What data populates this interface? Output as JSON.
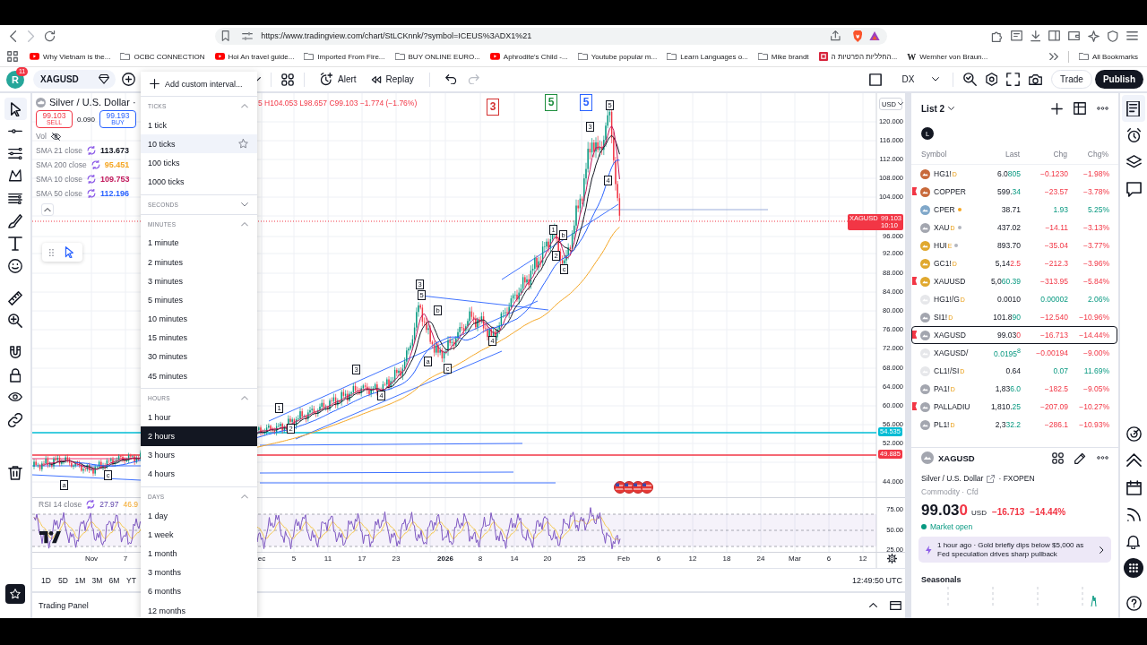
{
  "browser": {
    "url": "https://www.tradingview.com/chart/StLCKnnk/?symbol=ICEUS%3ADX1%21"
  },
  "bookmarks": {
    "items": [
      {
        "label": "Why Vietnam is the...",
        "kind": "video"
      },
      {
        "label": "OCBC CONNECTION",
        "kind": "folder"
      },
      {
        "label": "Hoi An travel guide...",
        "kind": "video"
      },
      {
        "label": "Imported From Fire...",
        "kind": "folder"
      },
      {
        "label": "BUY ONLINE EURO...",
        "kind": "folder"
      },
      {
        "label": "Aphrodite's Child -...",
        "kind": "video"
      },
      {
        "label": "Youtube popular m...",
        "kind": "folder"
      },
      {
        "label": "Learn Languages o...",
        "kind": "folder"
      },
      {
        "label": "Mike brandt",
        "kind": "folder"
      },
      {
        "label": "החלליות הפרטיות ה...",
        "kind": "site"
      },
      {
        "label": "Wernher von Braun...",
        "kind": "wiki",
        "glyph": "W"
      }
    ],
    "all": "All Bookmarks"
  },
  "header": {
    "avatar": "R",
    "notifications": "11",
    "symbol": "XAGUSD",
    "actions": [
      {
        "label": "Alert",
        "kind": "alert"
      },
      {
        "label": "Replay",
        "kind": "replay"
      }
    ],
    "history": [
      {
        "kind": "undo",
        "disabled": false
      },
      {
        "kind": "redo",
        "disabled": true
      }
    ],
    "compare": "DX",
    "buttons": [
      {
        "label": "Trade",
        "kind": "secondary"
      },
      {
        "label": "Publish",
        "kind": "primary"
      }
    ]
  },
  "interval_menu": {
    "add_label": "Add custom interval...",
    "groups": [
      {
        "title": "TICKS",
        "expanded": true,
        "items": [
          {
            "label": "1 tick",
            "selected": false,
            "hovered": false
          },
          {
            "label": "10 ticks",
            "selected": false,
            "hovered": true
          },
          {
            "label": "100 ticks",
            "selected": false,
            "hovered": false
          },
          {
            "label": "1000 ticks",
            "selected": false,
            "hovered": false
          }
        ]
      },
      {
        "title": "SECONDS",
        "expanded": false
      },
      {
        "title": "MINUTES",
        "expanded": true,
        "items": [
          {
            "label": "1 minute",
            "selected": false,
            "hovered": false
          },
          {
            "label": "2 minutes",
            "selected": false,
            "hovered": false
          },
          {
            "label": "3 minutes",
            "selected": false,
            "hovered": false
          },
          {
            "label": "5 minutes",
            "selected": false,
            "hovered": false
          },
          {
            "label": "10 minutes",
            "selected": false,
            "hovered": false
          },
          {
            "label": "15 minutes",
            "selected": false,
            "hovered": false
          },
          {
            "label": "30 minutes",
            "selected": false,
            "hovered": false
          },
          {
            "label": "45 minutes",
            "selected": false,
            "hovered": false
          }
        ]
      },
      {
        "title": "HOURS",
        "expanded": true,
        "items": [
          {
            "label": "1 hour",
            "selected": false,
            "hovered": false
          },
          {
            "label": "2 hours",
            "selected": true,
            "hovered": false
          },
          {
            "label": "3 hours",
            "selected": false,
            "hovered": false
          },
          {
            "label": "4 hours",
            "selected": false,
            "hovered": false
          }
        ]
      },
      {
        "title": "DAYS",
        "expanded": true,
        "items": [
          {
            "label": "1 day",
            "selected": false,
            "hovered": false
          },
          {
            "label": "1 week",
            "selected": false,
            "hovered": false
          },
          {
            "label": "1 month",
            "selected": false,
            "hovered": false
          },
          {
            "label": "3 months",
            "selected": false,
            "hovered": false
          },
          {
            "label": "6 months",
            "selected": false,
            "hovered": false
          },
          {
            "label": "12 months",
            "selected": false,
            "hovered": false
          }
        ]
      }
    ]
  },
  "left_tools": [
    {
      "items": [
        {
          "kind": "cursor",
          "selected": true
        },
        {
          "kind": "trend-line",
          "selected": false
        },
        {
          "kind": "lines",
          "selected": false
        },
        {
          "kind": "pattern",
          "selected": false
        },
        {
          "kind": "fib",
          "selected": false
        },
        {
          "kind": "brush",
          "selected": false
        },
        {
          "kind": "text",
          "selected": false
        },
        {
          "kind": "emoji",
          "selected": false
        }
      ]
    },
    {
      "items": [
        {
          "kind": "ruler",
          "selected": false
        },
        {
          "kind": "zoom",
          "selected": false
        }
      ]
    },
    {
      "items": [
        {
          "kind": "magnet",
          "selected": false
        },
        {
          "kind": "lock",
          "selected": false
        },
        {
          "kind": "eye",
          "selected": false
        },
        {
          "kind": "link",
          "selected": false
        }
      ]
    },
    {
      "items": [
        {
          "kind": "trash",
          "selected": false
        }
      ]
    }
  ],
  "legend": {
    "title": "Silver / U.S. Dollar ·",
    "sell_price": "99.103",
    "sell_label": "SELL",
    "spread": "0.090",
    "buy_price": "99.193",
    "buy_label": "BUY",
    "volume_label": "Vol",
    "volume_hidden": true,
    "indicators": [
      {
        "name": "SMA 21 close",
        "value": "113.673",
        "color": "#131722"
      },
      {
        "name": "SMA 200 close",
        "value": "95.451",
        "color": "#f5a623"
      },
      {
        "name": "SMA 10 close",
        "value": "109.753",
        "color": "#c2185b"
      },
      {
        "name": "SMA 50 close",
        "value": "112.196",
        "color": "#2962ff"
      }
    ]
  },
  "ohlc": {
    "text": "5 H104.053 L98.657 C99.103 −1.774 (−1.76%)",
    "rising": false
  },
  "chart": {
    "currency": "USD",
    "price_ticks": [
      "120.000",
      "116.000",
      "112.000",
      "108.000",
      "104.000",
      "96.000",
      "92.000",
      "88.000",
      "84.000",
      "80.000",
      "76.000",
      "72.000",
      "68.000",
      "64.000",
      "60.000",
      "56.000",
      "52.000",
      "44.000"
    ],
    "price_tags": [
      {
        "label": "XAGUSD",
        "value": "99.103",
        "time": "10:10",
        "color": "#f23645"
      },
      {
        "value": "54.535",
        "color": "#00bcd4"
      },
      {
        "value": "49.885",
        "color": "#f23645"
      }
    ],
    "wave_labels": [
      {
        "text": "3",
        "color": "#d32f2f",
        "kind": "major"
      },
      {
        "text": "5",
        "color": "#1e8e3e",
        "kind": "major"
      },
      {
        "text": "5",
        "color": "#2962ff",
        "kind": "major"
      },
      {
        "text": "5",
        "color": "#131722",
        "kind": "minor"
      },
      {
        "text": "3",
        "color": "#131722",
        "kind": "minor"
      },
      {
        "text": "4",
        "color": "#131722",
        "kind": "minor"
      },
      {
        "text": "1",
        "color": "#131722",
        "kind": "minor"
      },
      {
        "text": "b",
        "color": "#131722",
        "kind": "minor"
      },
      {
        "text": "2",
        "color": "#131722",
        "kind": "minor"
      },
      {
        "text": "c",
        "color": "#131722",
        "kind": "minor"
      },
      {
        "text": "3",
        "color": "#131722",
        "kind": "minor"
      },
      {
        "text": "5",
        "color": "#131722",
        "kind": "minor"
      },
      {
        "text": "b",
        "color": "#131722",
        "kind": "minor"
      },
      {
        "text": "4",
        "color": "#131722",
        "kind": "minor"
      },
      {
        "text": "3",
        "color": "#131722",
        "kind": "minor"
      },
      {
        "text": "a",
        "color": "#131722",
        "kind": "minor"
      },
      {
        "text": "c",
        "color": "#131722",
        "kind": "minor"
      },
      {
        "text": "4",
        "color": "#131722",
        "kind": "minor"
      },
      {
        "text": "1",
        "color": "#131722",
        "kind": "minor"
      },
      {
        "text": "2",
        "color": "#131722",
        "kind": "minor"
      },
      {
        "text": "c",
        "color": "#131722",
        "kind": "minor"
      },
      {
        "text": "a",
        "color": "#131722",
        "kind": "minor"
      }
    ],
    "time_ticks": [
      {
        "label": "Nov",
        "kind": "date"
      },
      {
        "label": "7",
        "kind": "date"
      },
      {
        "label": "ec",
        "kind": "date"
      },
      {
        "label": "5",
        "kind": "date"
      },
      {
        "label": "11",
        "kind": "date"
      },
      {
        "label": "17",
        "kind": "date"
      },
      {
        "label": "23",
        "kind": "date"
      },
      {
        "label": "2026",
        "kind": "year"
      },
      {
        "label": "8",
        "kind": "date"
      },
      {
        "label": "14",
        "kind": "date"
      },
      {
        "label": "20",
        "kind": "date"
      },
      {
        "label": "25",
        "kind": "date"
      },
      {
        "label": "Feb",
        "kind": "date"
      },
      {
        "label": "6",
        "kind": "date"
      },
      {
        "label": "12",
        "kind": "date"
      },
      {
        "label": "18",
        "kind": "date"
      },
      {
        "label": "24",
        "kind": "date"
      },
      {
        "label": "Mar",
        "kind": "date"
      },
      {
        "label": "6",
        "kind": "date"
      },
      {
        "label": "12",
        "kind": "date"
      }
    ]
  },
  "rsi": {
    "name": "RSI 14 close",
    "value": "27.97",
    "signal": "46.9",
    "ticks": [
      "75.00",
      "50.00",
      "25.00"
    ]
  },
  "ranges": [
    "1D",
    "5D",
    "1M",
    "3M",
    "6M",
    "YT"
  ],
  "clock": "12:49:50 UTC",
  "trading_panel": "Trading Panel",
  "watchlist": {
    "title": "List 2",
    "initial": "L",
    "columns": [
      "Symbol",
      "Last",
      "Chg",
      "Chg%"
    ],
    "rows": [
      {
        "symbol": "HG1!",
        "suffix": "D",
        "flagged": false,
        "color": "#c8693a",
        "last": "6.0",
        "last_tail": "805",
        "tail_rising": true,
        "change": "−0.1230",
        "change_pct": "−1.98%",
        "rising": false,
        "selected": false
      },
      {
        "symbol": "COPPER",
        "flagged": true,
        "color": "#c8693a",
        "last": "599.",
        "last_tail": "34",
        "tail_rising": true,
        "change": "−23.57",
        "change_pct": "−3.78%",
        "rising": false,
        "selected": false
      },
      {
        "symbol": "CPER",
        "dot": {
          "color": "#f5a623"
        },
        "flagged": false,
        "color": "#7fa7c9",
        "last": "38.71",
        "change": "1.93",
        "change_pct": "5.25%",
        "rising": true,
        "selected": false
      },
      {
        "symbol": "XAU",
        "suffix": "D",
        "dot": {
          "color": "#b2b5be"
        },
        "flagged": false,
        "color": "#a3a6af",
        "last": "437.02",
        "change": "−14.11",
        "change_pct": "−3.13%",
        "rising": false,
        "selected": false
      },
      {
        "symbol": "HUI",
        "suffix": "E",
        "dot": {
          "color": "#b2b5be"
        },
        "flagged": false,
        "color": "#e0a82e",
        "last": "893.70",
        "change": "−35.04",
        "change_pct": "−3.77%",
        "rising": false,
        "selected": false
      },
      {
        "symbol": "GC1!",
        "suffix": "D",
        "flagged": false,
        "color": "#e0a82e",
        "last": "5,14",
        "last_tail": "2.5",
        "tail_rising": false,
        "change": "−212.3",
        "change_pct": "−3.96%",
        "rising": false,
        "selected": false
      },
      {
        "symbol": "XAUUSD",
        "flagged": true,
        "color": "#e0a82e",
        "last": "5,0",
        "last_tail": "60.39",
        "tail_rising": true,
        "change": "−313.95",
        "change_pct": "−5.84%",
        "rising": false,
        "selected": false
      },
      {
        "symbol": "HG1!/G",
        "suffix": "D",
        "flagged": false,
        "color": "#e6e7ea",
        "last": "0.0010",
        "change": "0.00002",
        "change_pct": "2.06%",
        "rising": true,
        "selected": false
      },
      {
        "symbol": "SI1!",
        "suffix": "D",
        "flagged": false,
        "color": "#a3a6af",
        "last": "101.8",
        "last_tail": "90",
        "tail_rising": true,
        "change": "−12.540",
        "change_pct": "−10.96%",
        "rising": false,
        "selected": false
      },
      {
        "symbol": "XAGUSD",
        "flagged": true,
        "color": "#a3a6af",
        "last": "99.03",
        "last_tail": "0",
        "tail_rising": false,
        "change": "−16.713",
        "change_pct": "−14.44%",
        "rising": false,
        "selected": true
      },
      {
        "symbol": "XAGUSD/",
        "flagged": false,
        "color": "#e6e7ea",
        "last_tail": "0.0195$^{8}$",
        "tail_rising": true,
        "change": "−0.00194",
        "change_pct": "−9.00%",
        "rising": false,
        "selected": false
      },
      {
        "symbol": "CL1!/SI",
        "suffix": "D",
        "flagged": false,
        "color": "#e6e7ea",
        "last": "0.64",
        "change": "0.07",
        "change_pct": "11.69%",
        "rising": true,
        "selected": false
      },
      {
        "symbol": "PA1!",
        "suffix": "D",
        "flagged": false,
        "color": "#a3a6af",
        "last": "1,83",
        "last_tail": "6.0",
        "tail_rising": true,
        "change": "−182.5",
        "change_pct": "−9.05%",
        "rising": false,
        "selected": false
      },
      {
        "symbol": "PALLADIU",
        "flagged": true,
        "color": "#a3a6af",
        "last": "1,810.",
        "last_tail": "25",
        "tail_rising": true,
        "change": "−207.09",
        "change_pct": "−10.27%",
        "rising": false,
        "selected": false
      },
      {
        "symbol": "PL1!",
        "suffix": "D",
        "flagged": false,
        "color": "#a3a6af",
        "last": "2,3",
        "last_tail": "32.2",
        "tail_rising": true,
        "change": "−286.1",
        "change_pct": "−10.93%",
        "rising": false,
        "selected": false
      }
    ]
  },
  "details": {
    "symbol": "XAGUSD",
    "color": "#a3a6af",
    "description": "Silver / U.S. Dollar",
    "exchange": "· FXOPEN",
    "category": "Commodity · Cfd",
    "price": "99.03",
    "price_tail": "0",
    "tail_rising": false,
    "currency": "USD",
    "change": "−16.713",
    "change_pct": "−14.44%",
    "rising": false,
    "market_status": "Market open",
    "market_open": true,
    "news": "1 hour ago · Gold briefly dips below $5,000 as Fed speculation drives sharp pullback",
    "seasonals_title": "Seasonals"
  },
  "right_sidebar": [
    {
      "kind": "watchlist",
      "selected": true
    },
    {
      "kind": "alerts",
      "selected": false
    },
    {
      "kind": "layers",
      "selected": false
    },
    {
      "kind": "chat",
      "selected": false
    },
    {
      "kind": "target",
      "selected": false
    },
    {
      "kind": "ideas",
      "selected": false
    },
    {
      "kind": "calendar",
      "selected": false
    },
    {
      "kind": "streams",
      "selected": false
    },
    {
      "kind": "notifications",
      "selected": false
    },
    {
      "kind": "products",
      "selected": false
    },
    {
      "kind": "help",
      "selected": false
    }
  ]
}
